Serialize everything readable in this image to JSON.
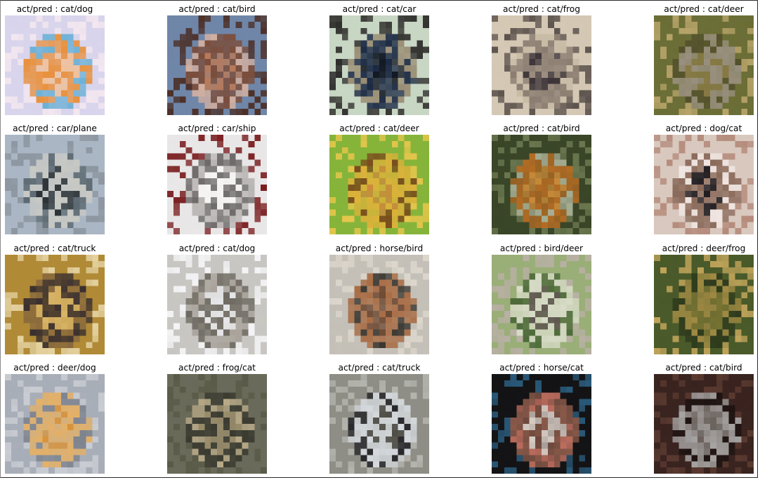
{
  "figure": {
    "cells": [
      {
        "caption": "act/pred : cat/dog",
        "subject": "cat",
        "palette": [
          "#d8d4ec",
          "#efc09a",
          "#e8903c",
          "#6ab0d6",
          "#f3e7ef"
        ]
      },
      {
        "caption": "act/pred : cat/bird",
        "subject": "cat",
        "palette": [
          "#6f86a8",
          "#b97a58",
          "#7b4d3a",
          "#d3b0a0",
          "#4c3028"
        ]
      },
      {
        "caption": "act/pred : cat/car",
        "subject": "cat",
        "palette": [
          "#c8d6c4",
          "#101722",
          "#1c2a44",
          "#9a8d74",
          "#2d2c2a"
        ]
      },
      {
        "caption": "act/pred : cat/frog",
        "subject": "cat",
        "palette": [
          "#d4c8b4",
          "#3c3438",
          "#8a7c70",
          "#c7bba5",
          "#5b524c"
        ]
      },
      {
        "caption": "act/pred : cat/deer",
        "subject": "cat",
        "palette": [
          "#6b6e36",
          "#8a7b46",
          "#9a9080",
          "#53502c",
          "#b7a46a"
        ]
      },
      {
        "caption": "act/pred : car/plane",
        "subject": "car",
        "palette": [
          "#aab6c4",
          "#2b3134",
          "#c8c9c4",
          "#5e6a72",
          "#8c96a0"
        ]
      },
      {
        "caption": "act/pred : car/ship",
        "subject": "car",
        "palette": [
          "#e8e6e6",
          "#f6f4f2",
          "#6e6a6a",
          "#b8b4b2",
          "#7a1e20"
        ]
      },
      {
        "caption": "act/pred : cat/deer",
        "subject": "cat",
        "palette": [
          "#86b43a",
          "#cc8a3c",
          "#dcb23a",
          "#7a4a1c",
          "#e6c64c"
        ]
      },
      {
        "caption": "act/pred : cat/bird",
        "subject": "cat",
        "palette": [
          "#3a4628",
          "#c88a3a",
          "#b46c24",
          "#a6ae94",
          "#6b7850"
        ]
      },
      {
        "caption": "act/pred : dog/cat",
        "subject": "dog",
        "palette": [
          "#d8c8be",
          "#1e1a1e",
          "#8a6a5a",
          "#f0e6e2",
          "#b48a7a"
        ]
      },
      {
        "caption": "act/pred : cat/truck",
        "subject": "cat",
        "palette": [
          "#b08a36",
          "#d8b468",
          "#3a3030",
          "#8a6a3c",
          "#e4d2a0"
        ]
      },
      {
        "caption": "act/pred : cat/dog",
        "subject": "cat",
        "palette": [
          "#c8c6c2",
          "#e6e6e8",
          "#6e6a62",
          "#a8a29a",
          "#f4f4f6"
        ]
      },
      {
        "caption": "act/pred : horse/bird",
        "subject": "horse",
        "palette": [
          "#c4c0b8",
          "#6e4a34",
          "#a86c44",
          "#3a3630",
          "#dcd6cc"
        ]
      },
      {
        "caption": "act/pred : bird/deer",
        "subject": "bird",
        "palette": [
          "#9aae78",
          "#5e5650",
          "#d8dcc8",
          "#4e6a3a",
          "#b8b0a4"
        ]
      },
      {
        "caption": "act/pred : deer/frog",
        "subject": "deer",
        "palette": [
          "#4a5a2a",
          "#7a7434",
          "#a08a44",
          "#2e3a1c",
          "#c0a45a"
        ]
      },
      {
        "caption": "act/pred : deer/dog",
        "subject": "deer",
        "palette": [
          "#a8aeb8",
          "#d8943c",
          "#e4b066",
          "#7e848e",
          "#c9ccd2"
        ]
      },
      {
        "caption": "act/pred : frog/cat",
        "subject": "frog",
        "palette": [
          "#6a6a5a",
          "#9c8e6c",
          "#3a3a30",
          "#b8aa88",
          "#5a5a48"
        ]
      },
      {
        "caption": "act/pred : cat/truck",
        "subject": "cat",
        "palette": [
          "#8e8e86",
          "#4a4a44",
          "#d6dade",
          "#26262a",
          "#b4b4ae"
        ]
      },
      {
        "caption": "act/pred : horse/cat",
        "subject": "horse",
        "palette": [
          "#141416",
          "#d8ccc4",
          "#8a5a4a",
          "#c07060",
          "#2a5a7a"
        ]
      },
      {
        "caption": "act/pred : cat/bird",
        "subject": "cat",
        "palette": [
          "#3a2420",
          "#7a7470",
          "#a6a4a2",
          "#1e1412",
          "#5a3a30"
        ]
      }
    ]
  }
}
